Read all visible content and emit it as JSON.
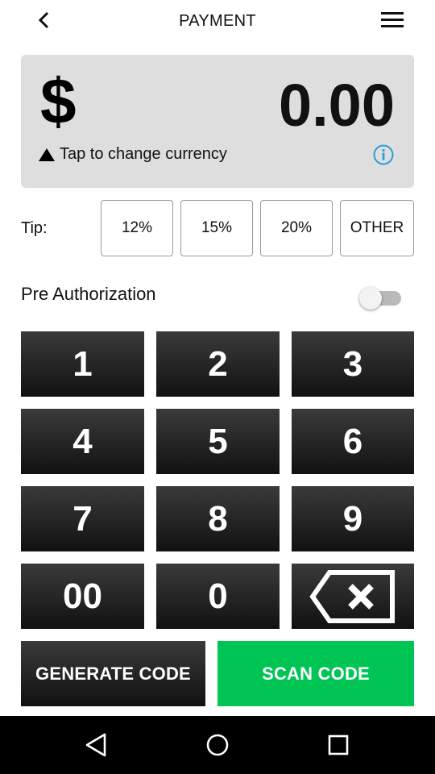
{
  "header": {
    "title": "PAYMENT",
    "back_icon": "chevron-left-icon",
    "menu_icon": "hamburger-menu-icon"
  },
  "amount_card": {
    "currency_symbol": "$",
    "amount": "0.00",
    "currency_hint": "Tap to change currency",
    "hint_icon": "triangle-up-icon",
    "info_icon": "info-circle-icon"
  },
  "tip": {
    "label": "Tip:",
    "options": [
      "12%",
      "15%",
      "20%",
      "OTHER"
    ]
  },
  "pre_authorization": {
    "label": "Pre Authorization",
    "enabled": false
  },
  "keypad": {
    "keys": [
      "1",
      "2",
      "3",
      "4",
      "5",
      "6",
      "7",
      "8",
      "9",
      "00",
      "0"
    ],
    "backspace_icon": "backspace-icon"
  },
  "actions": {
    "generate_label": "GENERATE CODE",
    "scan_label": "SCAN CODE"
  },
  "navbar": {
    "back_icon": "nav-back-triangle-icon",
    "home_icon": "nav-home-circle-icon",
    "recents_icon": "nav-recents-square-icon"
  },
  "colors": {
    "card_background": "#dedede",
    "key_dark": "#1a1a1a",
    "scan_green": "#00c454",
    "info_blue": "#2a9fd8",
    "navbar": "#000000"
  }
}
